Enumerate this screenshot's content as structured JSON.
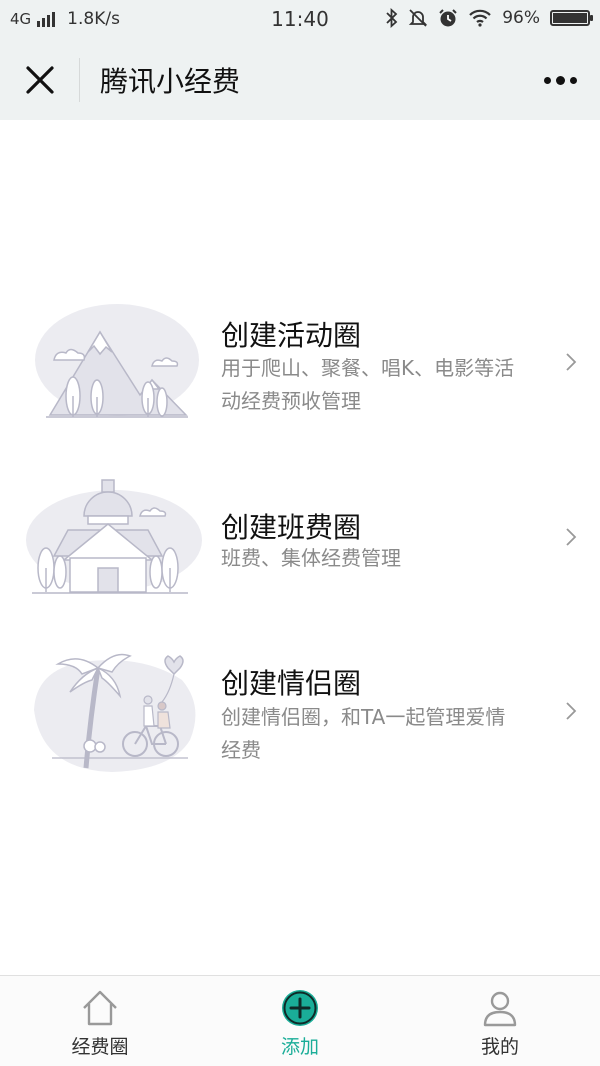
{
  "status_bar": {
    "network": "4G",
    "speed": "1.8K/s",
    "time": "11:40",
    "battery": "96%"
  },
  "header": {
    "title": "腾讯小经费"
  },
  "cards": [
    {
      "title": "创建活动圈",
      "desc_line1": "用于爬山、聚餐、唱K、电影等活",
      "desc_line2": "动经费预收管理",
      "illustration": "mountains-icon"
    },
    {
      "title": "创建班费圈",
      "desc_line1": "班费、集体经费管理",
      "illustration": "school-building-icon"
    },
    {
      "title": "创建情侣圈",
      "desc_line1": "创建情侣圈，和TA一起管理爱情",
      "desc_line2": "经费",
      "illustration": "couple-bicycle-icon"
    }
  ],
  "tabbar": {
    "tabs": [
      {
        "label": "经费圈",
        "icon": "home-icon"
      },
      {
        "label": "添加",
        "icon": "plus-circle-icon",
        "active": true
      },
      {
        "label": "我的",
        "icon": "person-icon"
      }
    ],
    "accent_color": "#1aad98"
  },
  "colors": {
    "header_bg": "#eef2f2",
    "desc_text": "#8a8a8a",
    "illustration_stroke": "#b8b8c8",
    "illustration_fill": "#ececf1"
  }
}
